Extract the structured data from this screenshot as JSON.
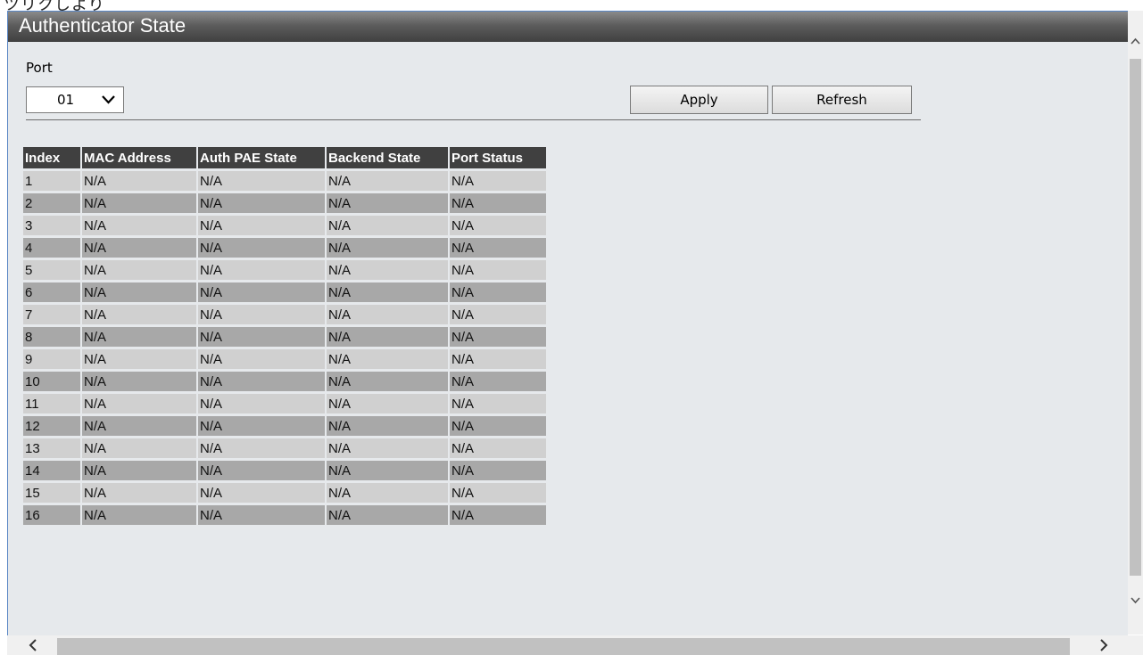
{
  "top_strip_text": "ツリクしより",
  "page": {
    "title": "Authenticator State"
  },
  "form": {
    "port_label": "Port",
    "port_value": "01",
    "apply_label": "Apply",
    "refresh_label": "Refresh"
  },
  "table": {
    "headers": [
      "Index",
      "MAC Address",
      "Auth PAE State",
      "Backend State",
      "Port Status"
    ],
    "rows": [
      [
        "1",
        "N/A",
        "N/A",
        "N/A",
        "N/A"
      ],
      [
        "2",
        "N/A",
        "N/A",
        "N/A",
        "N/A"
      ],
      [
        "3",
        "N/A",
        "N/A",
        "N/A",
        "N/A"
      ],
      [
        "4",
        "N/A",
        "N/A",
        "N/A",
        "N/A"
      ],
      [
        "5",
        "N/A",
        "N/A",
        "N/A",
        "N/A"
      ],
      [
        "6",
        "N/A",
        "N/A",
        "N/A",
        "N/A"
      ],
      [
        "7",
        "N/A",
        "N/A",
        "N/A",
        "N/A"
      ],
      [
        "8",
        "N/A",
        "N/A",
        "N/A",
        "N/A"
      ],
      [
        "9",
        "N/A",
        "N/A",
        "N/A",
        "N/A"
      ],
      [
        "10",
        "N/A",
        "N/A",
        "N/A",
        "N/A"
      ],
      [
        "11",
        "N/A",
        "N/A",
        "N/A",
        "N/A"
      ],
      [
        "12",
        "N/A",
        "N/A",
        "N/A",
        "N/A"
      ],
      [
        "13",
        "N/A",
        "N/A",
        "N/A",
        "N/A"
      ],
      [
        "14",
        "N/A",
        "N/A",
        "N/A",
        "N/A"
      ],
      [
        "15",
        "N/A",
        "N/A",
        "N/A",
        "N/A"
      ],
      [
        "16",
        "N/A",
        "N/A",
        "N/A",
        "N/A"
      ]
    ]
  },
  "icons": {
    "port_dropdown": "chevron-down-icon",
    "scroll_up": "chevron-up-icon",
    "scroll_down": "chevron-down-icon",
    "scroll_left": "chevron-left-icon",
    "scroll_right": "chevron-right-icon"
  },
  "colors": {
    "title_bar": "#404040",
    "header_bg": "#404040",
    "row_light": "#d0d0d0",
    "row_dark": "#a8a8a8",
    "panel_bg": "#e6e9ec"
  }
}
